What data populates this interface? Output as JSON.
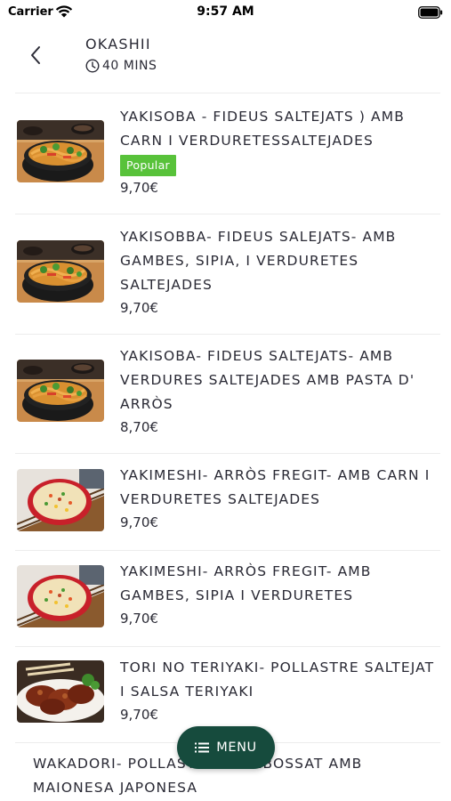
{
  "status_bar": {
    "carrier": "Carrier",
    "time": "9:57 AM"
  },
  "header": {
    "store_name": "OKASHII",
    "delivery_time": "40 MINS"
  },
  "items": [
    {
      "name": "YAKISOBA - FIDEUS SALTEJATS ) AMB CARN I VERDURETESSALTEJADES",
      "badge": "Popular",
      "price": "9,70€",
      "image": "yakisoba-noodles-bowl"
    },
    {
      "name": "YAKISOBBA- FIDEUS SALEJATS- AMB GAMBES, SIPIA, I VERDURETES SALTEJADES",
      "price": "9,70€",
      "image": "yakisoba-noodles-bowl"
    },
    {
      "name": "YAKISOBA- FIDEUS SALTEJATS- AMB VERDURES SALTEJADES AMB PASTA D' ARRÒS",
      "price": "8,70€",
      "image": "yakisoba-noodles-bowl"
    },
    {
      "name": "YAKIMESHI- ARRÒS FREGIT- AMB CARN I VERDURETES SALTEJADES",
      "price": "9,70€",
      "image": "fried-rice-bowl"
    },
    {
      "name": "YAKIMESHI- ARRÒS FREGIT- AMB GAMBES, SIPIA I VERDURETES",
      "price": "9,70€",
      "image": "fried-rice-bowl"
    },
    {
      "name": "TORI NO TERIYAKI- POLLASTRE SALTEJAT I SALSA TERIYAKI",
      "price": "9,70€",
      "image": "teriyaki-chicken-plate"
    },
    {
      "name": "WAKADORI- POLLASTRE ARREBOSSAT AMB MAIONESA JAPONESA"
    }
  ],
  "menu_button": {
    "label": "MENU",
    "icon": "list-icon"
  },
  "colors": {
    "badge_green": "#58c23a",
    "menu_button_bg": "#164b3d",
    "text": "#2a2a35",
    "divider": "#ececec"
  }
}
